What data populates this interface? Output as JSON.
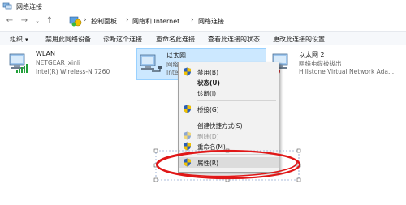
{
  "window": {
    "title": "网络连接"
  },
  "address": {
    "crumbs": [
      "控制面板",
      "网络和 Internet",
      "网络连接"
    ]
  },
  "commandbar": {
    "organize": "组织",
    "disable": "禁用此网络设备",
    "diagnose": "诊断这个连接",
    "rename": "重命名此连接",
    "status": "查看此连接的状态",
    "change": "更改此连接的设置"
  },
  "connections": [
    {
      "name": "WLAN",
      "status": "NETGEAR_xinli",
      "adapter": "Intel(R) Wireless-N 7260"
    },
    {
      "name": "以太网",
      "status": "网络",
      "adapter": "Intel"
    },
    {
      "name": "以太网 2",
      "status": "网络电缆被拔出",
      "adapter": "Hillstone Virtual Network Ada..."
    }
  ],
  "context_menu": {
    "items": [
      {
        "label": "禁用(B)"
      },
      {
        "label": "状态(U)"
      },
      {
        "label": "诊断(I)"
      },
      {
        "label": "桥接(G)"
      },
      {
        "label": "创建快捷方式(S)"
      },
      {
        "label": "删除(D)"
      },
      {
        "label": "重命名(M)"
      },
      {
        "label": "属性(R)"
      }
    ]
  },
  "colors": {
    "selection_bg": "#cce8ff",
    "annotation_red": "#e01818",
    "shield_blue": "#2a5fb8",
    "shield_yellow": "#f2c200"
  }
}
